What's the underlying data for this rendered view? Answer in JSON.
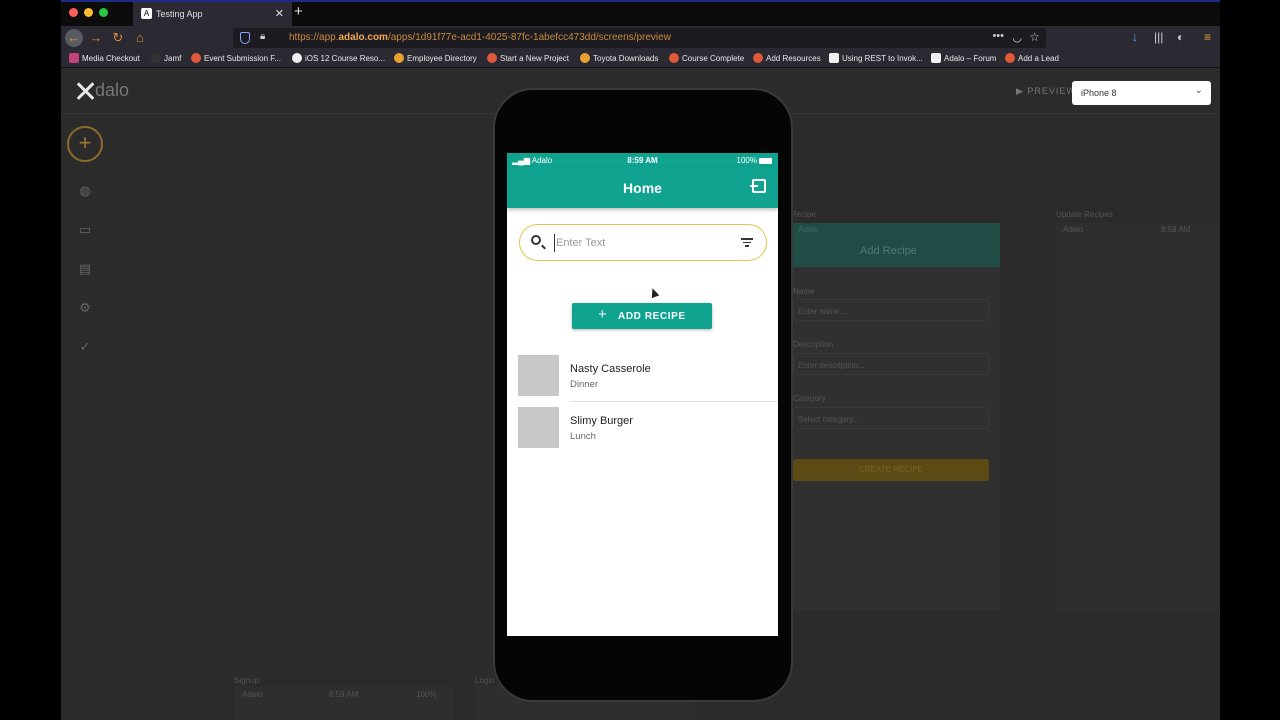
{
  "browser": {
    "tab_title": "Testing App",
    "tab_favicon_glyph": "A",
    "new_tab_glyph": "+",
    "close_tab_glyph": "✕",
    "url_prefix": "https://app.",
    "url_domain": "adalo.com",
    "url_path": "/apps/1d91f77e-acd1-4025-87fc-1abefcc473dd/screens/preview",
    "bookmarks": [
      {
        "label": "Media Checkout",
        "color": "#c0427a"
      },
      {
        "label": "Jamf",
        "color": "#333333"
      },
      {
        "label": "Event Submission F...",
        "color": "#e05a3a"
      },
      {
        "label": "iOS 12 Course Reso...",
        "color": "#f0f0f0"
      },
      {
        "label": "Employee Directory",
        "color": "#e8a030"
      },
      {
        "label": "Start a New Project",
        "color": "#e05a3a"
      },
      {
        "label": "Toyota Downloads",
        "color": "#e8a030"
      },
      {
        "label": "Course Complete",
        "color": "#e05a3a"
      },
      {
        "label": "Add Resources",
        "color": "#e05a3a"
      },
      {
        "label": "Using REST to Invok...",
        "color": "#f0f0f0"
      },
      {
        "label": "Adalo – Forum",
        "color": "#f0f0f0"
      },
      {
        "label": "Add a Lead",
        "color": "#e05a3a"
      }
    ]
  },
  "editor": {
    "logo_text": "dalo",
    "preview_label": "▶ PREVIEW",
    "device_selected": "iPhone 8",
    "bg_screens": {
      "add_recipe_label": "Recipe",
      "update_recipes_label": "Update Recipes",
      "add_recipe_title": "Add Recipe",
      "name_label": "Name",
      "name_placeholder": "Enter name...",
      "description_label": "Description",
      "description_placeholder": "Enter description...",
      "category_label": "Category",
      "category_placeholder": "Select category...",
      "create_button": "CREATE RECIPE",
      "signup_label": "Signup",
      "login_label": "Login",
      "adalo_small": "Adalo",
      "time_small": "8:59 AM",
      "battery_small": "100%"
    }
  },
  "phone": {
    "carrier": "Adalo",
    "time": "8:59 AM",
    "battery": "100%",
    "screen_title": "Home",
    "search_placeholder": "Enter Text",
    "add_button_label": "ADD RECIPE",
    "recipes": [
      {
        "name": "Nasty Casserole",
        "category": "Dinner"
      },
      {
        "name": "Slimy Burger",
        "category": "Lunch"
      }
    ]
  },
  "colors": {
    "primary": "#0fa390",
    "search_border": "#e8c44a",
    "thumb": "#c8c8c8"
  }
}
